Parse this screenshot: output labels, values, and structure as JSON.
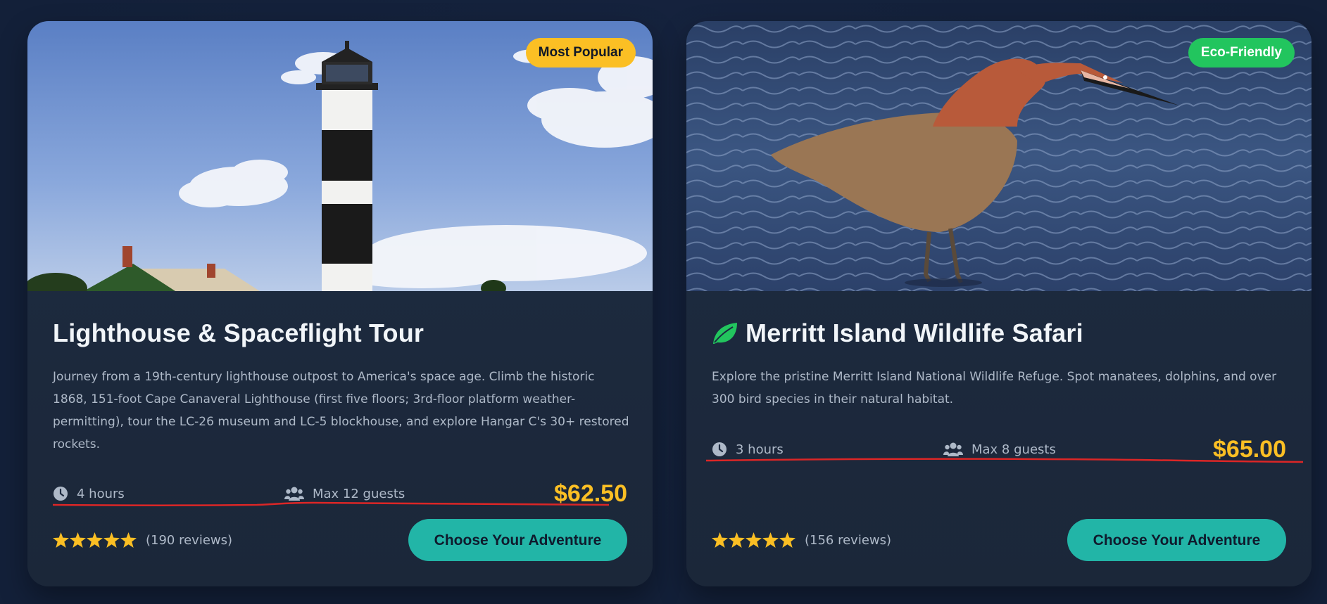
{
  "tours": [
    {
      "badge": "Most Popular",
      "title": "Lighthouse & Spaceflight Tour",
      "description": "Journey from a 19th-century lighthouse outpost to America's space age. Climb the historic 1868, 151-foot Cape Canaveral Lighthouse (first five floors; 3rd-floor platform weather-permitting), tour the LC-26 museum and LC-5 blockhouse, and explore Hangar C's 30+ restored rockets.",
      "duration": "4 hours",
      "guests": "Max 12 guests",
      "price": "$62.50",
      "rating": 5,
      "reviews": "(190 reviews)",
      "cta": "Choose Your Adventure",
      "image_icon": "lighthouse-photo"
    },
    {
      "badge": "Eco-Friendly",
      "title": "Merritt Island Wildlife Safari",
      "description": "Explore the pristine Merritt Island National Wildlife Refuge. Spot manatees, dolphins, and over 300 bird species in their natural habitat.",
      "duration": "3 hours",
      "guests": "Max 8 guests",
      "price": "$65.00",
      "rating": 5,
      "reviews": "(156 reviews)",
      "cta": "Choose Your Adventure",
      "title_icon": "leaf-icon",
      "image_icon": "egret-photo"
    }
  ],
  "colors": {
    "background": "#132039",
    "card": "#1e2c42",
    "accent_price": "#fbbf24",
    "badge_popular": "#fbbf24",
    "badge_eco": "#22c55e",
    "cta": "#22b5a7",
    "annotation_underline": "#dc2626"
  }
}
